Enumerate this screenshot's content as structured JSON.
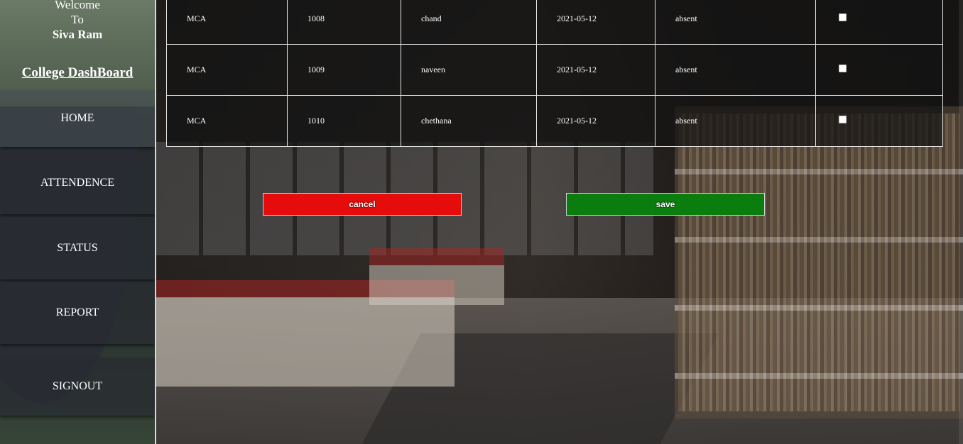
{
  "sidebar": {
    "welcome_line1": "Welcome",
    "welcome_line2": "To",
    "user_name": "Siva Ram",
    "brand": "College DashBoard",
    "nav": {
      "home": "HOME",
      "attendence": "ATTENDENCE",
      "status": "STATUS",
      "report": "REPORT",
      "signout": "SIGNOUT"
    }
  },
  "table": {
    "rows": [
      {
        "course": "MCA",
        "id": "1008",
        "name": "chand",
        "date": "2021-05-12",
        "status": "absent",
        "checked": false
      },
      {
        "course": "MCA",
        "id": "1009",
        "name": "naveen",
        "date": "2021-05-12",
        "status": "absent",
        "checked": false
      },
      {
        "course": "MCA",
        "id": "1010",
        "name": "chethana",
        "date": "2021-05-12",
        "status": "absent",
        "checked": false
      }
    ]
  },
  "buttons": {
    "cancel": "cancel",
    "save": "save"
  },
  "colors": {
    "cancel": "#e60c0c",
    "save": "#0b7d0f"
  }
}
